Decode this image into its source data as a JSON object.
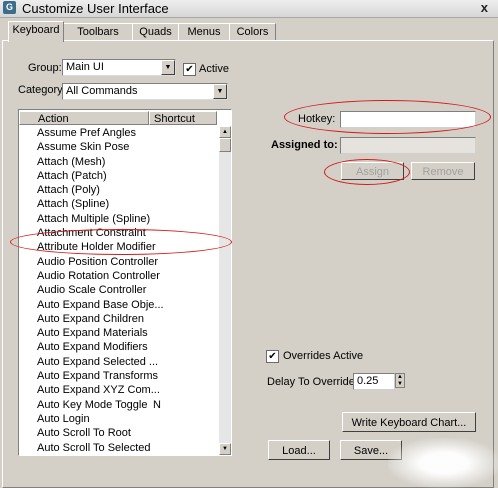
{
  "window": {
    "title": "Customize User Interface",
    "close_glyph": "x"
  },
  "tabs": [
    {
      "label": "Keyboard",
      "active": true
    },
    {
      "label": "Toolbars"
    },
    {
      "label": "Quads"
    },
    {
      "label": "Menus"
    },
    {
      "label": "Colors"
    }
  ],
  "keyboard": {
    "group_label": "Group:",
    "group_value": "Main UI",
    "active_label": "Active",
    "active_checked": true,
    "category_label": "Category:",
    "category_value": "All Commands",
    "columns": {
      "action": "Action",
      "shortcut": "Shortcut"
    },
    "actions": [
      {
        "action": "Assume Pref Angles",
        "shortcut": ""
      },
      {
        "action": "Assume Skin Pose",
        "shortcut": ""
      },
      {
        "action": "Attach (Mesh)",
        "shortcut": ""
      },
      {
        "action": "Attach (Patch)",
        "shortcut": ""
      },
      {
        "action": "Attach (Poly)",
        "shortcut": ""
      },
      {
        "action": "Attach (Spline)",
        "shortcut": ""
      },
      {
        "action": "Attach Multiple (Spline)",
        "shortcut": ""
      },
      {
        "action": "Attachment Constraint",
        "shortcut": ""
      },
      {
        "action": "Attribute Holder Modifier",
        "shortcut": ""
      },
      {
        "action": "Audio Position Controller",
        "shortcut": ""
      },
      {
        "action": "Audio Rotation Controller",
        "shortcut": ""
      },
      {
        "action": "Audio Scale Controller",
        "shortcut": ""
      },
      {
        "action": "Auto Expand Base Obje...",
        "shortcut": ""
      },
      {
        "action": "Auto Expand Children",
        "shortcut": ""
      },
      {
        "action": "Auto Expand Materials",
        "shortcut": ""
      },
      {
        "action": "Auto Expand Modifiers",
        "shortcut": ""
      },
      {
        "action": "Auto Expand Selected ...",
        "shortcut": ""
      },
      {
        "action": "Auto Expand Transforms",
        "shortcut": ""
      },
      {
        "action": "Auto Expand XYZ Com...",
        "shortcut": ""
      },
      {
        "action": "Auto Key Mode Toggle",
        "shortcut": "N"
      },
      {
        "action": "Auto Login",
        "shortcut": ""
      },
      {
        "action": "Auto Scroll To Root",
        "shortcut": ""
      },
      {
        "action": "Auto Scroll To Selected",
        "shortcut": ""
      }
    ],
    "hotkey_label": "Hotkey:",
    "hotkey_value": "",
    "assigned_label": "Assigned to:",
    "assigned_value": "",
    "assign_label": "Assign",
    "remove_label": "Remove",
    "overrides_label": "Overrides Active",
    "overrides_checked": true,
    "delay_label": "Delay To Override:",
    "delay_value": "0.25",
    "write_chart_label": "Write Keyboard Chart...",
    "load_label": "Load...",
    "save_label": "Save..."
  },
  "annotation_color": "#d41a1a",
  "check_glyph": "✔"
}
